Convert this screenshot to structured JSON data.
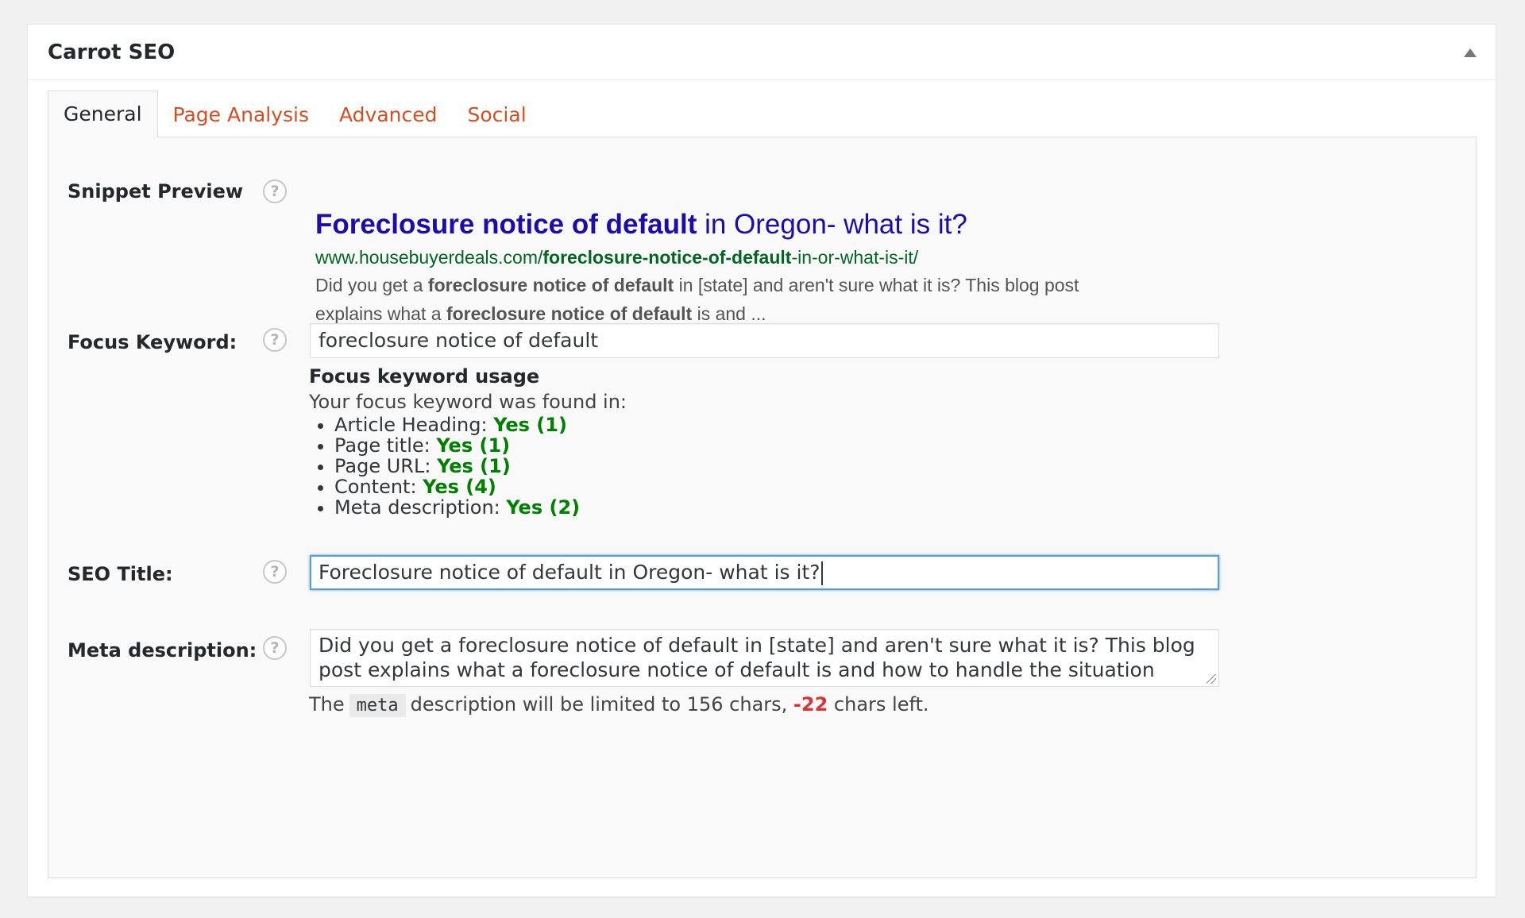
{
  "panel": {
    "title": "Carrot SEO"
  },
  "tabs": [
    {
      "label": "General",
      "active": true
    },
    {
      "label": "Page Analysis",
      "active": false
    },
    {
      "label": "Advanced",
      "active": false
    },
    {
      "label": "Social",
      "active": false
    }
  ],
  "labels": {
    "snippet_preview": "Snippet Preview",
    "focus_keyword": "Focus Keyword:",
    "seo_title": "SEO Title:",
    "meta_description": "Meta description:",
    "help_glyph": "?"
  },
  "snippet": {
    "title_bold": "Foreclosure notice of default",
    "title_rest": " in Oregon- what is it?",
    "url_prefix": "www.housebuyerdeals.com/",
    "url_bold": "foreclosure-notice-of-default",
    "url_suffix": "-in-or-what-is-it/",
    "desc_1": "Did you get a ",
    "desc_bold_1": "foreclosure notice of default",
    "desc_2": " in [state] and aren't sure what it is? This blog post explains what a ",
    "desc_bold_2": "foreclosure notice of default",
    "desc_3": " is and ..."
  },
  "focus_keyword": {
    "value": "foreclosure notice of default"
  },
  "usage": {
    "title": "Focus keyword usage",
    "intro": "Your focus keyword was found in:",
    "items": [
      {
        "label": "Article Heading: ",
        "result": "Yes (1)"
      },
      {
        "label": "Page title: ",
        "result": "Yes (1)"
      },
      {
        "label": "Page URL: ",
        "result": "Yes (1)"
      },
      {
        "label": "Content: ",
        "result": "Yes (4)"
      },
      {
        "label": "Meta description: ",
        "result": "Yes (2)"
      }
    ]
  },
  "seo_title": {
    "value": "Foreclosure notice of default in Oregon- what is it?"
  },
  "meta_description": {
    "value": "Did you get a foreclosure notice of default in [state] and aren't sure what it is? This blog post explains what a foreclosure notice of default is and how to handle the situation"
  },
  "limit_note": {
    "prefix": "The",
    "code": "meta",
    "middle": "description will be limited to 156 chars, ",
    "count": "-22",
    "suffix": " chars left."
  },
  "colors": {
    "accent_link": "#d54e21",
    "snippet_title": "#1a0dab",
    "snippet_url": "#006621",
    "success": "#008000",
    "error": "#dc3232",
    "focus_border": "#5b9dd9"
  }
}
